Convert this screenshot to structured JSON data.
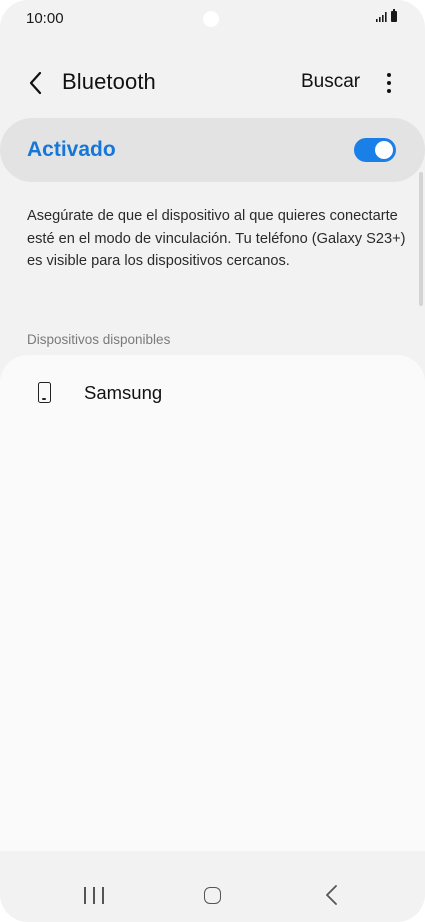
{
  "status_bar": {
    "time": "10:00"
  },
  "header": {
    "title": "Bluetooth",
    "search_label": "Buscar"
  },
  "master_switch": {
    "label": "Activado",
    "checked": true,
    "accent_color": "#1677d9"
  },
  "description": "Asegúrate de que el dispositivo al que quieres conectarte esté en el modo de vinculación. Tu teléfono (Galaxy S23+) es visible para los dispositivos cercanos.",
  "available_devices": {
    "header": "Dispositivos disponibles",
    "items": [
      {
        "name": "Samsung",
        "icon": "smartphone-icon"
      }
    ]
  },
  "nav_bar": {
    "icons": [
      "recents-icon",
      "home-icon",
      "back-icon"
    ]
  }
}
